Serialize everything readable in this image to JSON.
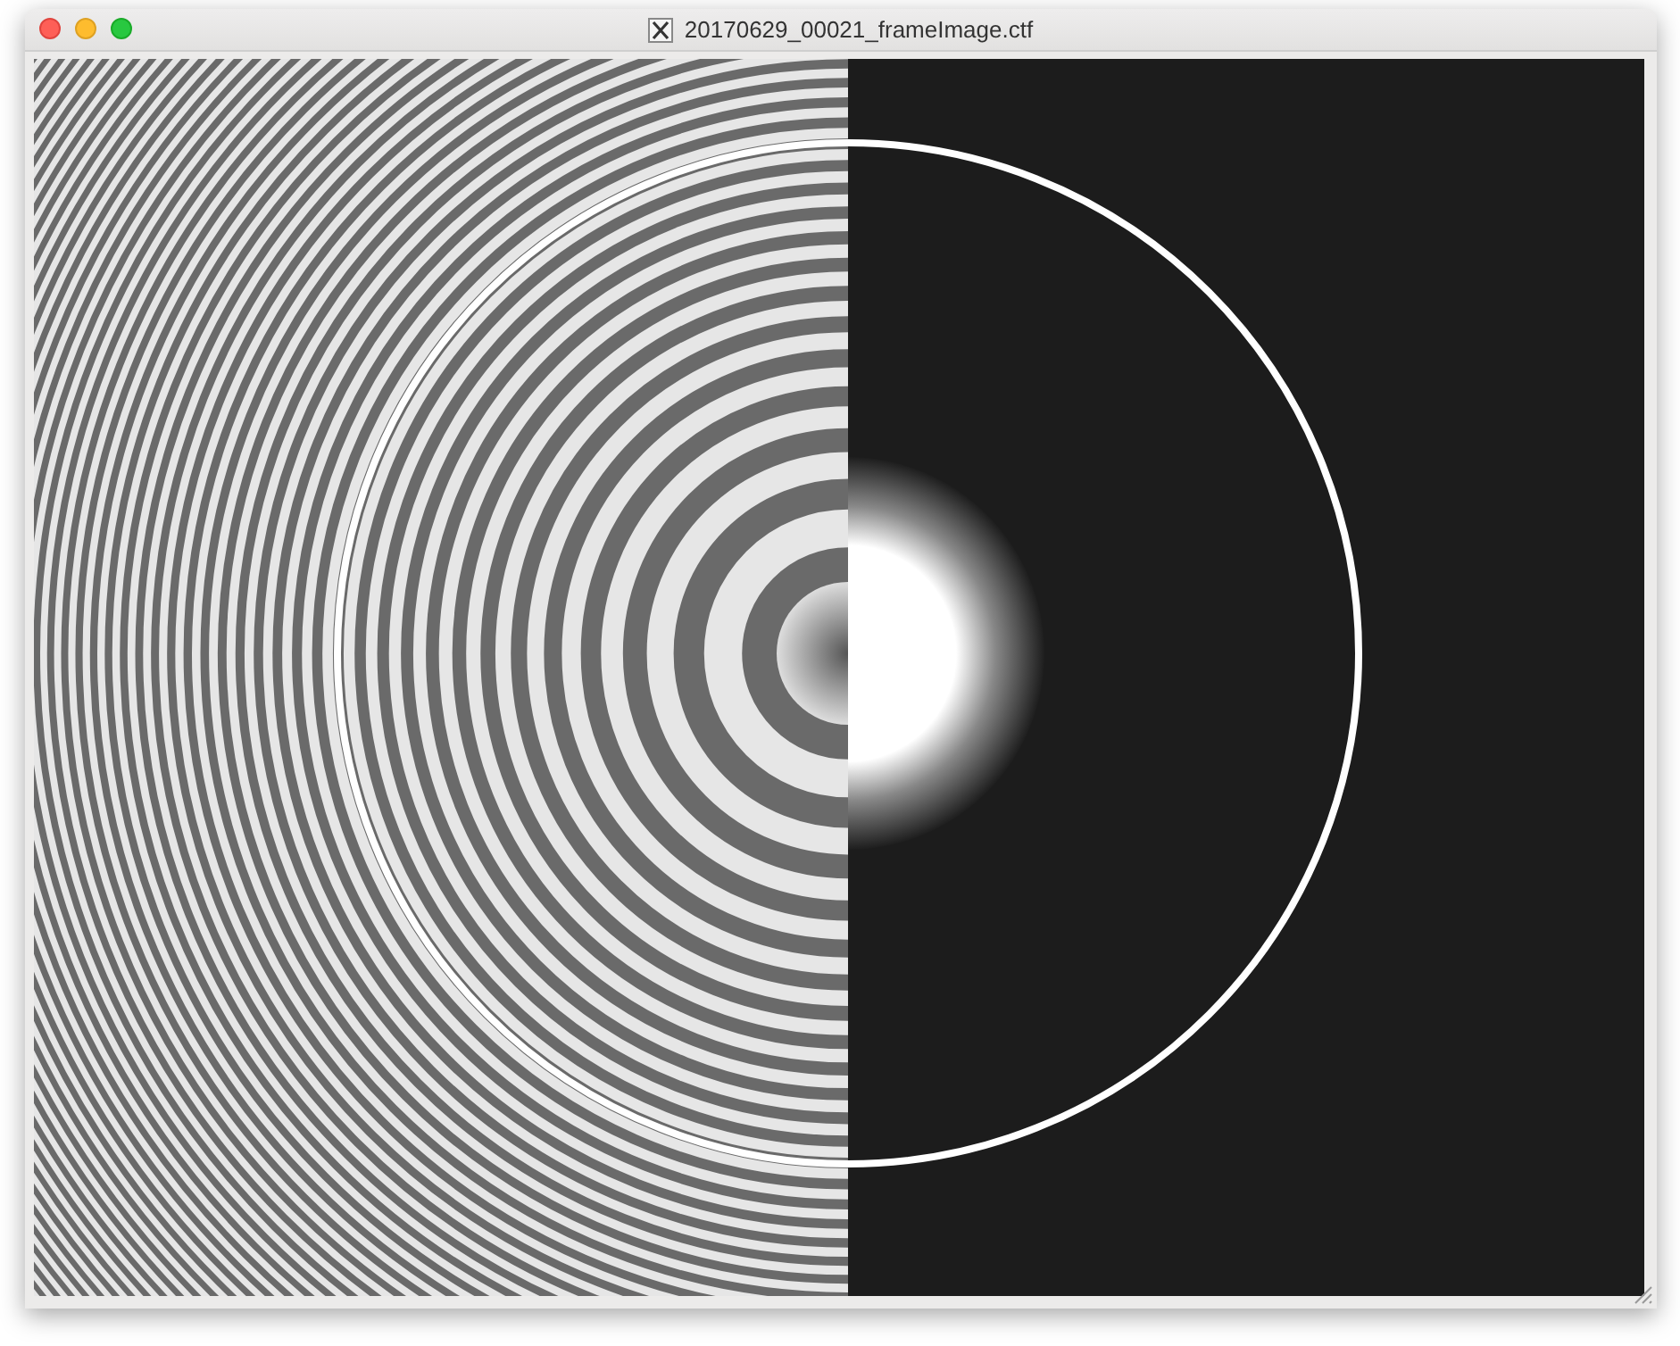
{
  "window": {
    "title": "20170629_00021_frameImage.ctf"
  }
}
